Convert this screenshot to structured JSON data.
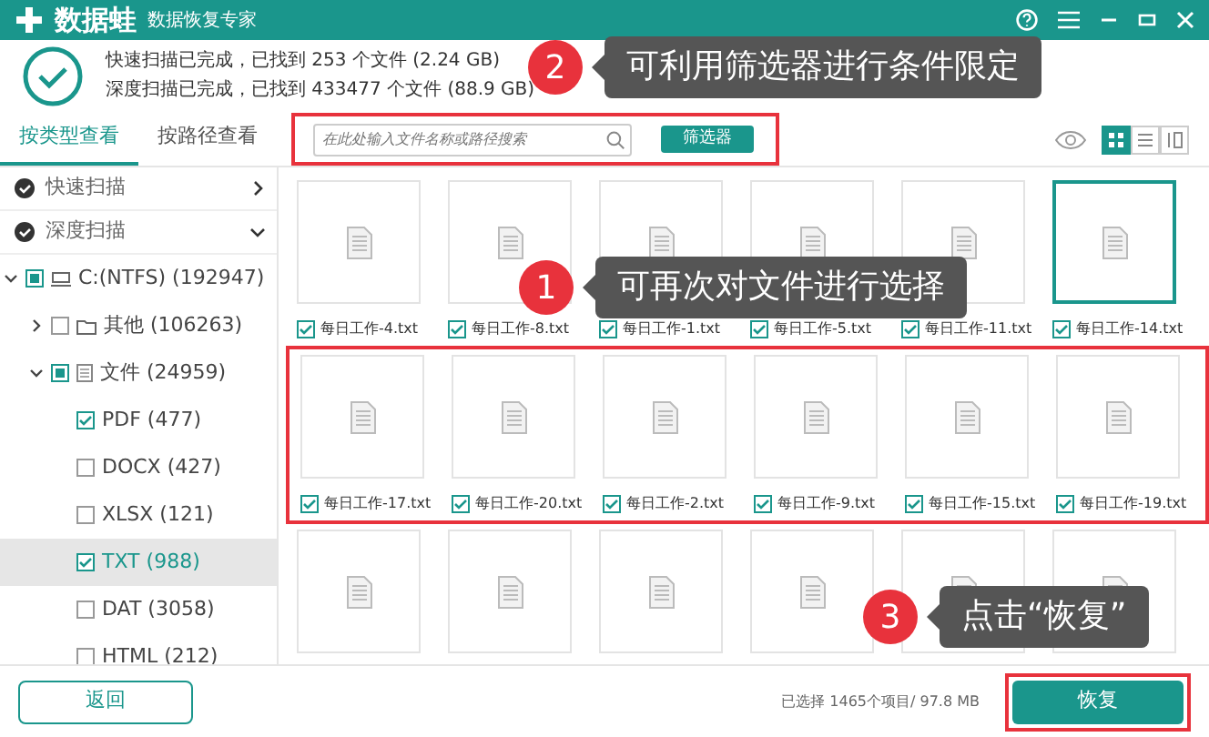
{
  "window": {
    "app_name": "数据蛙",
    "subtitle": "数据恢复专家"
  },
  "scan_summary": [
    "快速扫描已完成，已找到 253 个文件 (2.24 GB)",
    "深度扫描已完成，已找到 433477 个文件 (88.9 GB)"
  ],
  "tabs": [
    {
      "label": "按类型查看",
      "selected": true
    },
    {
      "label": "按路径查看",
      "selected": false
    }
  ],
  "search": {
    "placeholder": "在此处输入文件名称或路径搜索",
    "highlighted": true
  },
  "filter_button": "筛选器",
  "views": [
    {
      "kind": "grid",
      "selected": true
    },
    {
      "kind": "list",
      "selected": false
    },
    {
      "kind": "detail",
      "selected": false
    }
  ],
  "sidebar": {
    "scans": [
      {
        "label": "快速扫描",
        "expanded": false
      },
      {
        "label": "深度扫描",
        "expanded": true
      }
    ],
    "tree": [
      {
        "label": "C:(NTFS) (192947)",
        "kind": "drive",
        "partial": true,
        "expanded": true,
        "selected": false,
        "children": [
          {
            "label": "其他 (106263)",
            "kind": "folder",
            "checked": false,
            "partial": false,
            "expanded": false,
            "selected": false
          },
          {
            "label": "文件 (24959)",
            "kind": "doc",
            "partial": true,
            "expanded": true,
            "selected": false,
            "children": [
              {
                "label": "PDF (477)",
                "checked": true,
                "partial": false,
                "selected": false
              },
              {
                "label": "DOCX (427)",
                "checked": false,
                "partial": false,
                "selected": false
              },
              {
                "label": "XLSX (121)",
                "checked": false,
                "partial": false,
                "selected": false
              },
              {
                "label": "TXT (988)",
                "checked": true,
                "partial": false,
                "selected": true
              },
              {
                "label": "DAT (3058)",
                "checked": false,
                "partial": false,
                "selected": false
              },
              {
                "label": "HTML (212)",
                "checked": false,
                "partial": false,
                "selected": false
              }
            ]
          }
        ]
      }
    ]
  },
  "file_rows": [
    {
      "highlighted": false,
      "files": [
        {
          "name": "每日工作-4.txt",
          "checked": true,
          "selected": false
        },
        {
          "name": "每日工作-8.txt",
          "checked": true,
          "selected": false
        },
        {
          "name": "每日工作-1.txt",
          "checked": true,
          "selected": false
        },
        {
          "name": "每日工作-5.txt",
          "checked": true,
          "selected": false
        },
        {
          "name": "每日工作-11.txt",
          "checked": true,
          "selected": false
        },
        {
          "name": "每日工作-14.txt",
          "checked": true,
          "selected": true
        }
      ]
    },
    {
      "highlighted": true,
      "files": [
        {
          "name": "每日工作-17.txt",
          "checked": true,
          "selected": false
        },
        {
          "name": "每日工作-20.txt",
          "checked": true,
          "selected": false
        },
        {
          "name": "每日工作-2.txt",
          "checked": true,
          "selected": false
        },
        {
          "name": "每日工作-9.txt",
          "checked": true,
          "selected": false
        },
        {
          "name": "每日工作-15.txt",
          "checked": true,
          "selected": false
        },
        {
          "name": "每日工作-19.txt",
          "checked": true,
          "selected": false
        }
      ]
    },
    {
      "highlighted": false,
      "files": [
        {
          "selected": false
        },
        {
          "selected": false
        },
        {
          "selected": false
        },
        {
          "selected": false
        },
        {
          "selected": false
        },
        {
          "selected": false
        }
      ]
    }
  ],
  "footer": {
    "back_button": "返回",
    "status": "已选择 1465个项目/ 97.8 MB",
    "recover_button": "恢复",
    "recover_highlighted": true
  },
  "callouts": [
    {
      "number": "2",
      "text": "可利用筛选器进行条件限定"
    },
    {
      "number": "1",
      "text": "可再次对文件进行选择"
    },
    {
      "number": "3",
      "text": "点击“恢复”"
    }
  ]
}
